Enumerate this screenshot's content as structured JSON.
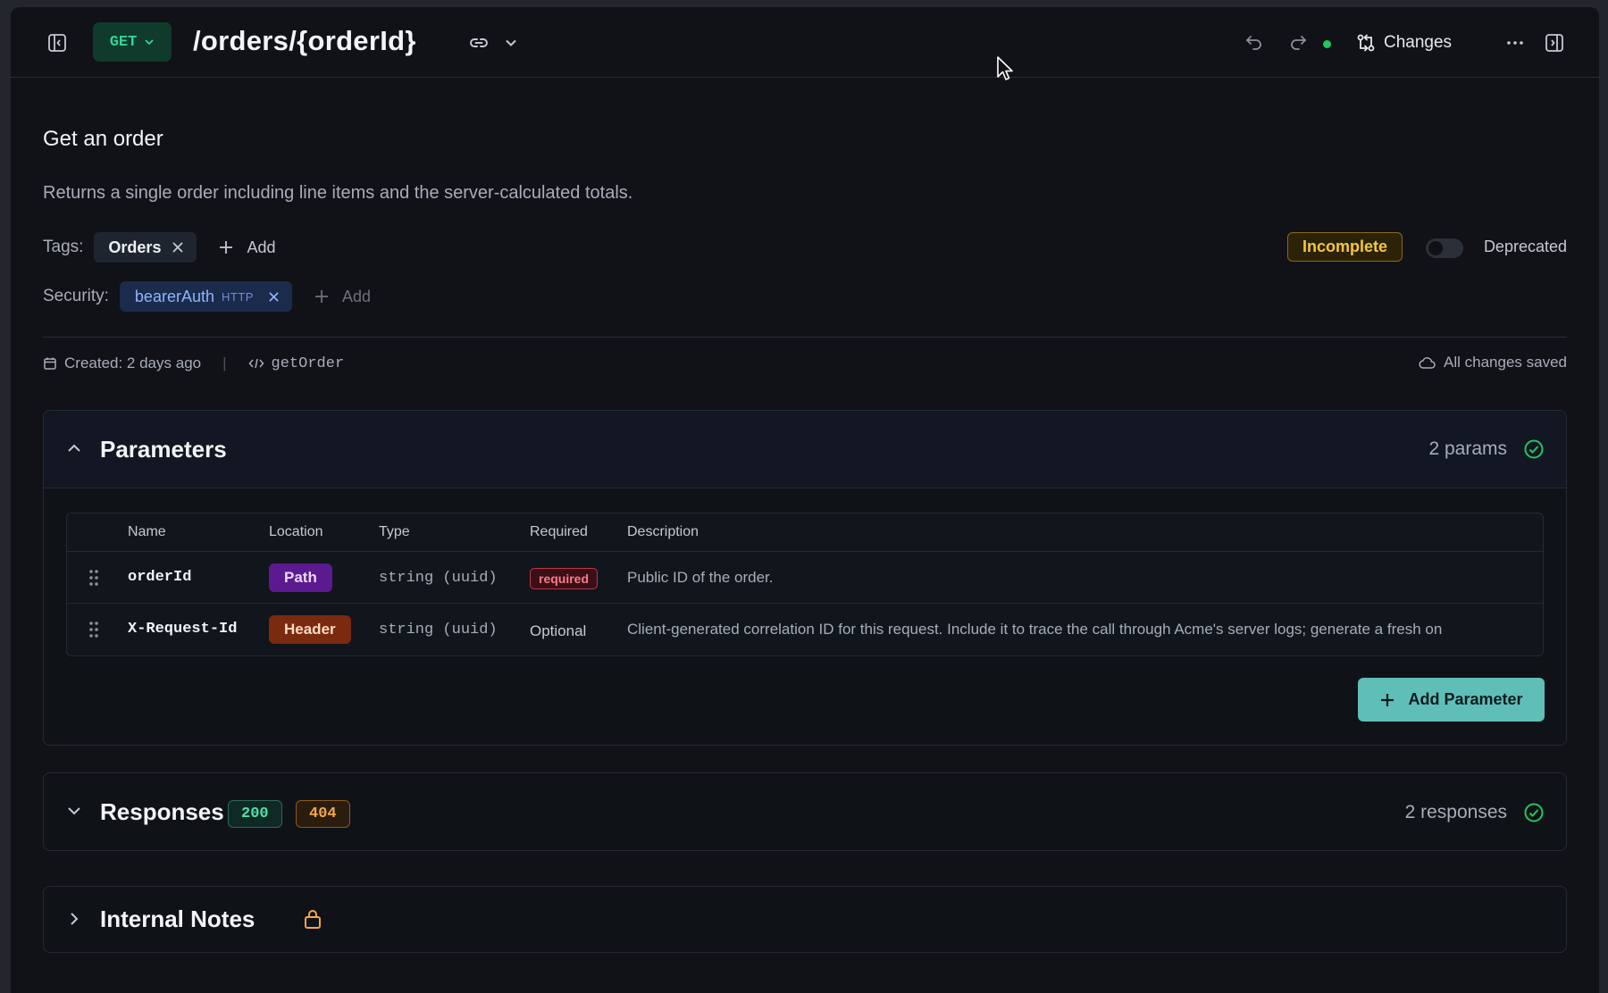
{
  "topbar": {
    "sidebar_toggle_icon": "sidebar-left-icon",
    "method": "GET",
    "path": "/orders/{orderId}",
    "link_icon": "link-icon",
    "more_menu_icon": "chevron-down-icon",
    "undo_icon": "undo-icon",
    "redo_icon": "redo-icon",
    "status": "connected",
    "changes_label": "Changes",
    "overflow_icon": "more-horizontal-icon",
    "right_panel_icon": "sidebar-right-icon"
  },
  "operation": {
    "summary": "Get an order",
    "description": "Returns a single order including line items and the server-calculated totals."
  },
  "tags": {
    "label": "Tags:",
    "items": [
      "Orders"
    ],
    "add_label": "Add",
    "status_badge": "Incomplete",
    "deprecated_label": "Deprecated",
    "deprecated": false
  },
  "security": {
    "label": "Security:",
    "scheme": "bearerAuth",
    "scheme_type": "HTTP",
    "add_label": "Add"
  },
  "meta": {
    "created": "Created: 2 days ago",
    "operation_id": "getOrder",
    "save_status": "All changes saved"
  },
  "parameters": {
    "title": "Parameters",
    "count": "2 params",
    "columns": [
      "Name",
      "Location",
      "Type",
      "Required",
      "Description"
    ],
    "rows": [
      {
        "name": "orderId",
        "location": "Path",
        "type": "string (uuid)",
        "required": "required",
        "description": "Public ID of the order."
      },
      {
        "name": "X-Request-Id",
        "location": "Header",
        "type": "string (uuid)",
        "required": "Optional",
        "description": "Client-generated correlation ID for this request. Include it to trace the call through Acme's server logs; generate a fresh on"
      }
    ],
    "add_button": "Add Parameter"
  },
  "responses": {
    "title": "Responses",
    "codes": [
      "200",
      "404"
    ],
    "count": "2 responses"
  },
  "notes": {
    "title": "Internal Notes",
    "icon": "lock-icon"
  },
  "colors": {
    "get": "#34d399",
    "path_badge": "#5b1a8f",
    "header_badge": "#7a2a0e",
    "incomplete": "#f5c542",
    "accent_button": "#5fbfb8",
    "success": "#22c55e"
  }
}
